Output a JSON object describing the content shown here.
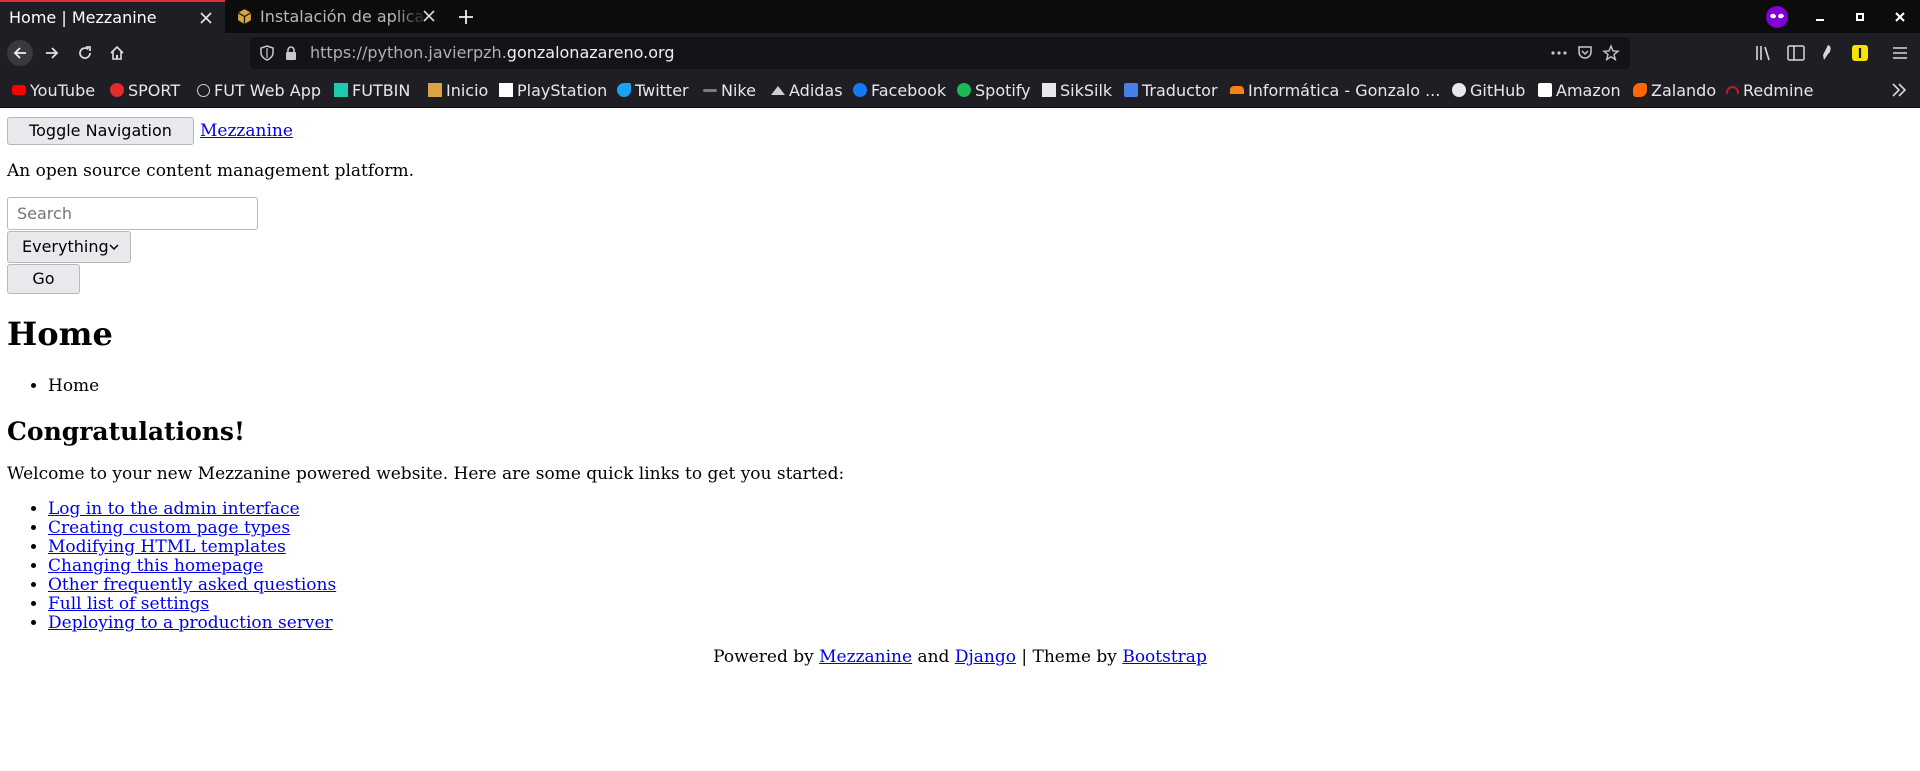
{
  "browser": {
    "tabs": [
      {
        "title": "Home | Mezzanine",
        "active": true
      },
      {
        "title": "Instalación de aplicaci",
        "active": false
      }
    ],
    "url": {
      "prefix": "https://python.javierpzh.",
      "domain": "gonzalonazareno.org"
    },
    "bookmarks": [
      {
        "label": "YouTube",
        "icon": "youtube-icon",
        "color": "#ff0000"
      },
      {
        "label": "SPORT",
        "icon": "sport-icon",
        "color": "#e32b2b"
      },
      {
        "label": "FUT Web App",
        "icon": "globe-icon",
        "color": "#cfcfd2"
      },
      {
        "label": "FUTBIN",
        "icon": "futbin-icon",
        "color": "#1ec9b0"
      },
      {
        "label": "Inicio",
        "icon": "cube-icon",
        "color": "#d9a441"
      },
      {
        "label": "PlayStation",
        "icon": "playstation-icon",
        "color": "#ffffff"
      },
      {
        "label": "Twitter",
        "icon": "twitter-icon",
        "color": "#1da1f2"
      },
      {
        "label": "Nike",
        "icon": "nike-icon",
        "color": "#7a7a7e"
      },
      {
        "label": "Adidas",
        "icon": "adidas-icon",
        "color": "#cfcfd2"
      },
      {
        "label": "Facebook",
        "icon": "facebook-icon",
        "color": "#1877f2"
      },
      {
        "label": "Spotify",
        "icon": "spotify-icon",
        "color": "#1db954"
      },
      {
        "label": "SikSilk",
        "icon": "siksilk-icon",
        "color": "#e8e8ea"
      },
      {
        "label": "Traductor",
        "icon": "translate-icon",
        "color": "#4a7fe8"
      },
      {
        "label": "Informática - Gonzalo ...",
        "icon": "moodle-icon",
        "color": "#f98012"
      },
      {
        "label": "GitHub",
        "icon": "github-icon",
        "color": "#e8e8ea"
      },
      {
        "label": "Amazon",
        "icon": "amazon-icon",
        "color": "#ffffff"
      },
      {
        "label": "Zalando",
        "icon": "zalando-icon",
        "color": "#ff6900"
      },
      {
        "label": "Redmine",
        "icon": "redmine-icon",
        "color": "#b32024"
      }
    ]
  },
  "site": {
    "toggle_nav_label": "Toggle Navigation",
    "brand": "Mezzanine",
    "tagline": "An open source content management platform.",
    "search": {
      "placeholder": "Search",
      "scope": "Everything",
      "go_label": "Go"
    },
    "page_title": "Home",
    "breadcrumb": [
      "Home"
    ],
    "heading": "Congratulations!",
    "welcome": "Welcome to your new Mezzanine powered website. Here are some quick links to get you started:",
    "quick_links": [
      "Log in to the admin interface",
      "Creating custom page types",
      "Modifying HTML templates",
      "Changing this homepage",
      "Other frequently asked questions",
      "Full list of settings",
      "Deploying to a production server"
    ],
    "footer": {
      "powered_by": "Powered by",
      "mezzanine": "Mezzanine",
      "and": "and",
      "django": "Django",
      "theme_by": "| Theme by",
      "bootstrap": "Bootstrap"
    }
  },
  "colors": {
    "link": "#0000ee",
    "tab_accent": "#e62e35",
    "chrome_bg": "#1f1e25",
    "private_badge": "#8000d7"
  }
}
